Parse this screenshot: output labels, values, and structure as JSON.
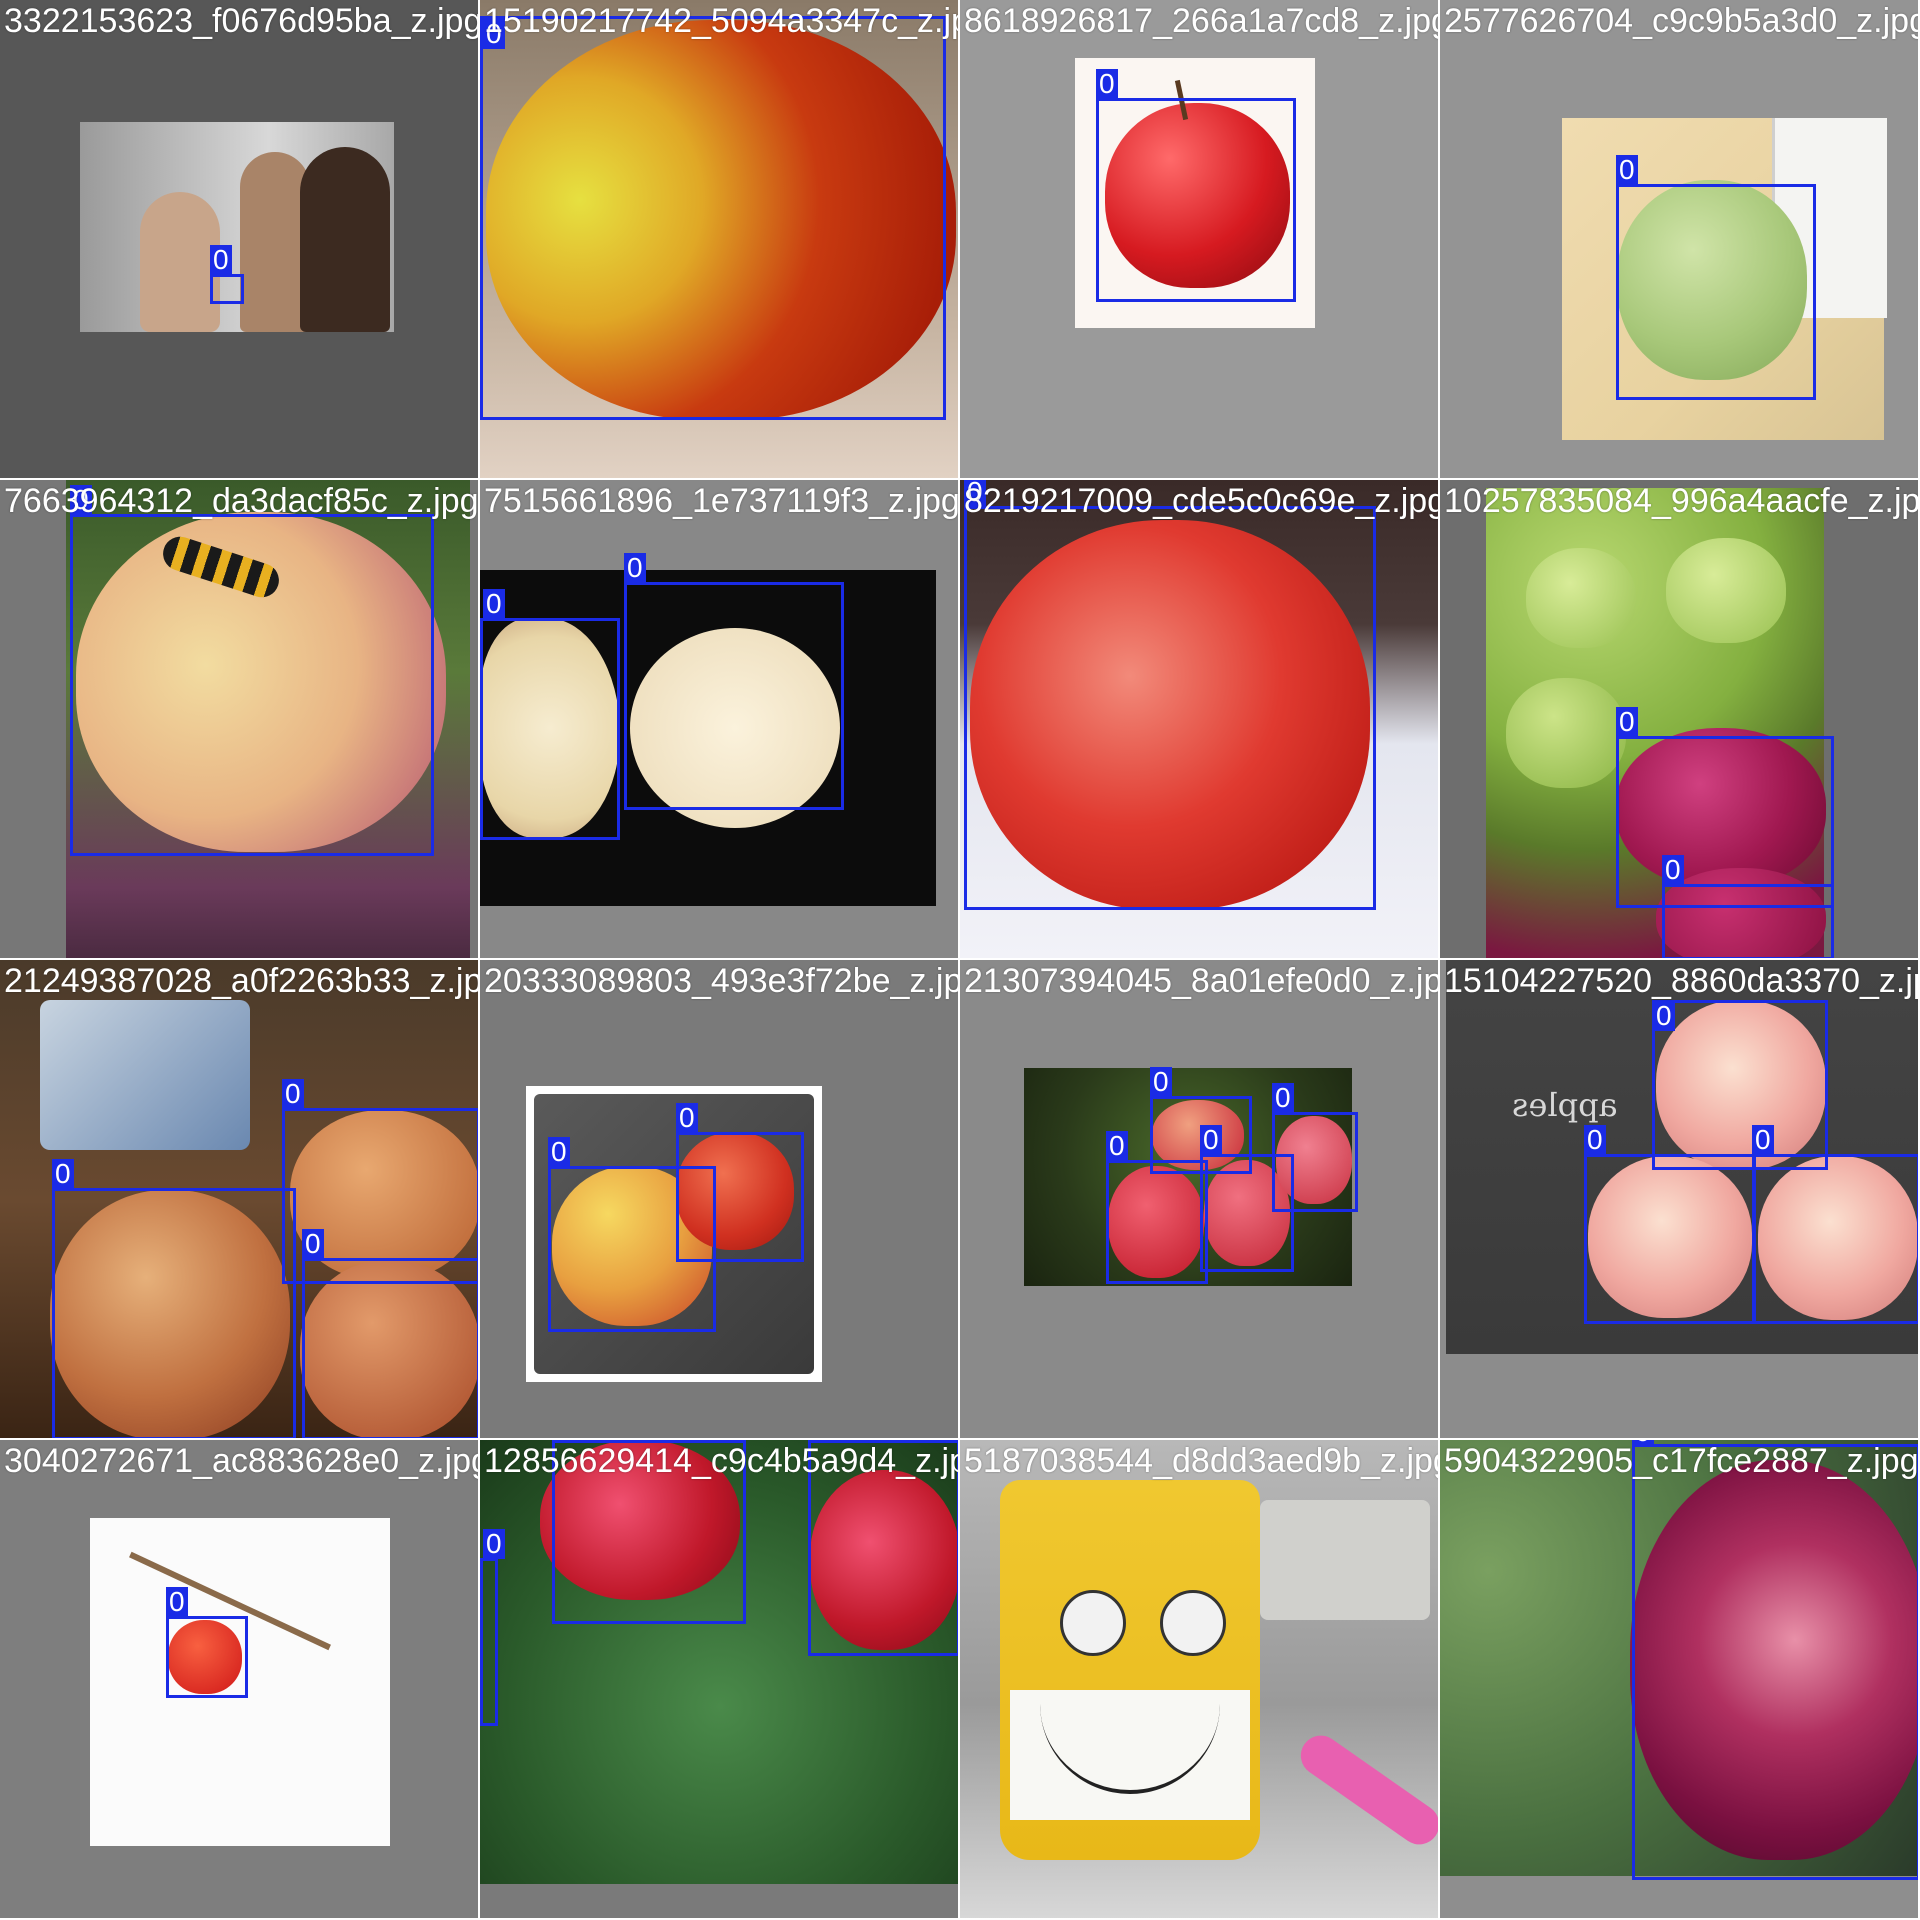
{
  "box_color": "#1a2be6",
  "tiles": [
    {
      "filename": "3322153623_f0676d95ba_z.jpg",
      "labels": [
        "0"
      ]
    },
    {
      "filename": "15190217742_5094a3347c_z.jpg",
      "labels": [
        "0"
      ]
    },
    {
      "filename": "8618926817_266a1a7cd8_z.jpg",
      "labels": [
        "0"
      ]
    },
    {
      "filename": "2577626704_c9c9b5a3d0_z.jpg",
      "labels": [
        "0"
      ]
    },
    {
      "filename": "7663964312_da3dacf85c_z.jpg",
      "labels": [
        "0"
      ]
    },
    {
      "filename": "7515661896_1e737119f3_z.jpg",
      "labels": [
        "0",
        "0"
      ]
    },
    {
      "filename": "8219217009_cde5c0c69e_z.jpg",
      "labels": [
        "0"
      ]
    },
    {
      "filename": "10257835084_996a4aacfe_z.jpg",
      "labels": [
        "0",
        "0"
      ]
    },
    {
      "filename": "21249387028_a0f2263b33_z.jpg",
      "labels": [
        "0",
        "0",
        "0"
      ]
    },
    {
      "filename": "20333089803_493e3f72be_z.jpg",
      "labels": [
        "0",
        "0"
      ]
    },
    {
      "filename": "21307394045_8a01efe0d0_z.jpg",
      "labels": [
        "0",
        "0",
        "0",
        "0"
      ]
    },
    {
      "filename": "15104227520_8860da3370_z.jpg",
      "labels": [
        "0",
        "0",
        "0"
      ]
    },
    {
      "filename": "3040272671_ac883628e0_z.jpg",
      "labels": [
        "0"
      ]
    },
    {
      "filename": "12856629414_c9c4b5a9d4_z.jpg",
      "labels": [
        "0",
        "0",
        "0"
      ]
    },
    {
      "filename": "5187038544_d8dd3aed9b_z.jpg",
      "labels": []
    },
    {
      "filename": "5904322905_c17fce2887_z.jpg",
      "labels": [
        "0"
      ]
    }
  ],
  "tile_texts": {
    "apples_chalk": "apples"
  }
}
